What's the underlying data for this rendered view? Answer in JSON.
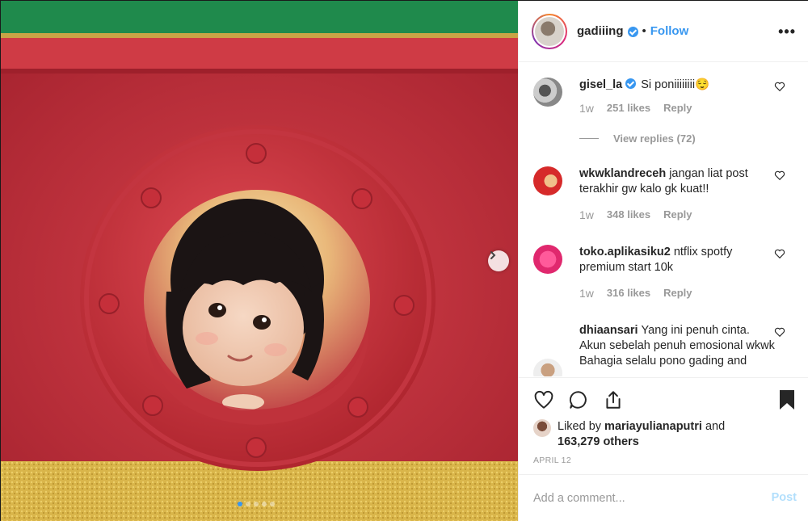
{
  "post": {
    "username": "gadiiing",
    "bullet": "•",
    "follow_label": "Follow",
    "more_label": "•••",
    "liked_by_prefix": "Liked by ",
    "liked_by_user": "mariayulianaputri",
    "liked_by_suffix": " and",
    "liked_count": "163,279 others",
    "date": "APRIL 12",
    "carousel_total": 5,
    "carousel_active": 1
  },
  "comments": [
    {
      "user": "gisel_la",
      "verified": true,
      "text": "Si poniiiiiiii😌",
      "time": "1w",
      "likes": "251 likes",
      "reply": "Reply",
      "view_replies": "View replies (72)"
    },
    {
      "user": "wkwklandreceh",
      "text": "jangan liat post terakhir gw kalo gk kuat!!",
      "time": "1w",
      "likes": "348 likes",
      "reply": "Reply"
    },
    {
      "user": "toko.aplikasiku2",
      "text": "ntflix spotfy premium start 10k",
      "time": "1w",
      "likes": "316 likes",
      "reply": "Reply"
    },
    {
      "user": "dhiaansari",
      "text": "Yang ini penuh cinta. Akun sebelah penuh emosional wkwk Bahagia selalu pono gading and",
      "time": "1w",
      "likes": "",
      "reply": ""
    }
  ],
  "add_comment": {
    "placeholder": "Add a comment...",
    "post_label": "Post"
  },
  "colors": {
    "accent": "#3897f0",
    "text": "#262626",
    "muted": "#999999",
    "post_disabled": "#b2dffc"
  }
}
